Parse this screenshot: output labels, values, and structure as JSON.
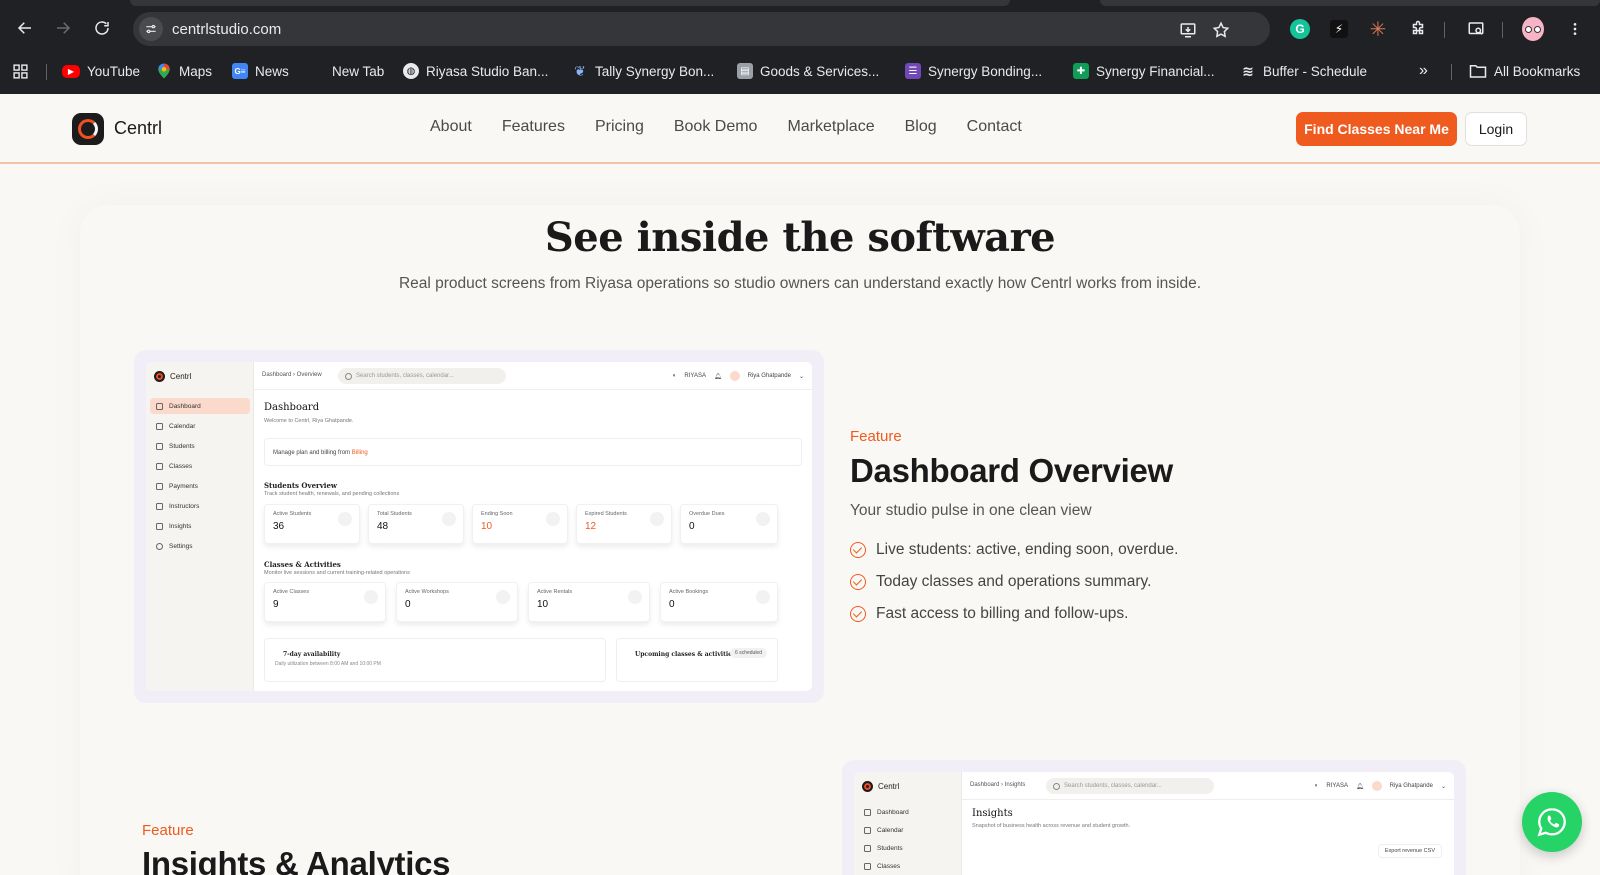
{
  "browser": {
    "url": "centrlstudio.com",
    "bookmarks": [
      {
        "label": "YouTube",
        "icon": "youtube-icon",
        "color": "#ff0000"
      },
      {
        "label": "Maps",
        "icon": "maps-icon",
        "color": "#34a853"
      },
      {
        "label": "News",
        "icon": "news-icon",
        "color": "#4285f4"
      },
      {
        "label": "New Tab",
        "icon": "",
        "color": ""
      },
      {
        "label": "Riyasa Studio Ban...",
        "icon": "globe-icon",
        "color": "#e8eaed"
      },
      {
        "label": "Tally Synergy Bon...",
        "icon": "tally-icon",
        "color": "#8ab4f8"
      },
      {
        "label": "Goods & Services...",
        "icon": "document-icon",
        "color": "#9aa0a6"
      },
      {
        "label": "Synergy Bonding...",
        "icon": "forms-icon",
        "color": "#7248b9"
      },
      {
        "label": "Synergy Financial...",
        "icon": "sheets-icon",
        "color": "#0f9d58"
      },
      {
        "label": "Buffer - Schedule",
        "icon": "buffer-icon",
        "color": "#e8eaed"
      }
    ],
    "all_bookmarks": "All Bookmarks",
    "overflow": "»"
  },
  "site": {
    "logo": "Centrl",
    "nav": [
      "About",
      "Features",
      "Pricing",
      "Book Demo",
      "Marketplace",
      "Blog",
      "Contact"
    ],
    "cta": "Find Classes Near Me",
    "login": "Login",
    "accent": "#ef5a1f"
  },
  "section": {
    "title": "See inside the software",
    "subtitle": "Real product screens from Riyasa operations so studio owners can understand exactly how Centrl works from inside."
  },
  "feature1": {
    "label": "Feature",
    "title": "Dashboard Overview",
    "subtitle": "Your studio pulse in one clean view",
    "points": [
      "Live students: active, ending soon, overdue.",
      "Today classes and operations summary.",
      "Fast access to billing and follow-ups."
    ]
  },
  "feature2": {
    "label": "Feature",
    "title": "Insights & Analytics"
  },
  "mock1": {
    "logo": "Centrl",
    "sidebar": [
      "Dashboard",
      "Calendar",
      "Students",
      "Classes",
      "Payments",
      "Instructors",
      "Insights",
      "Settings"
    ],
    "crumb": "Dashboard  ›  Overview",
    "search": "Search students, classes, calendar...",
    "org": "RIYASA",
    "user": "Riya Ghatpande",
    "heading": "Dashboard",
    "welcome": "Welcome to Centrl, Riya Ghatpande.",
    "billing_text": "Manage plan and billing from",
    "billing_link": "Billing",
    "students_title": "Students Overview",
    "students_sub": "Track student health, renewals, and pending collections",
    "student_cards": [
      {
        "label": "Active Students",
        "value": "36",
        "accent": false
      },
      {
        "label": "Total Students",
        "value": "48",
        "accent": false
      },
      {
        "label": "Ending Soon",
        "value": "10",
        "accent": true
      },
      {
        "label": "Expired Students",
        "value": "12",
        "accent": true
      },
      {
        "label": "Overdue Dues",
        "value": "0",
        "accent": false
      }
    ],
    "classes_title": "Classes & Activities",
    "classes_sub": "Monitor live sessions and current training-related operations",
    "class_cards": [
      {
        "label": "Active Classes",
        "value": "9"
      },
      {
        "label": "Active Workshops",
        "value": "0"
      },
      {
        "label": "Active Rentals",
        "value": "10"
      },
      {
        "label": "Active Bookings",
        "value": "0"
      }
    ],
    "availability_title": "7-day availability",
    "availability_sub": "Daily utilization between 8:00 AM and 10:00 PM",
    "upcoming_title": "Upcoming classes & activities",
    "upcoming_badge": "6 scheduled"
  },
  "mock2": {
    "logo": "Centrl",
    "sidebar": [
      "Dashboard",
      "Calendar",
      "Students",
      "Classes"
    ],
    "crumb": "Dashboard  ›  Insights",
    "search": "Search students, classes, calendar...",
    "org": "RIYASA",
    "user": "Riya Ghatpande",
    "heading": "Insights",
    "sub": "Snapshot of business health across revenue and student growth.",
    "export": "Export revenue CSV"
  }
}
